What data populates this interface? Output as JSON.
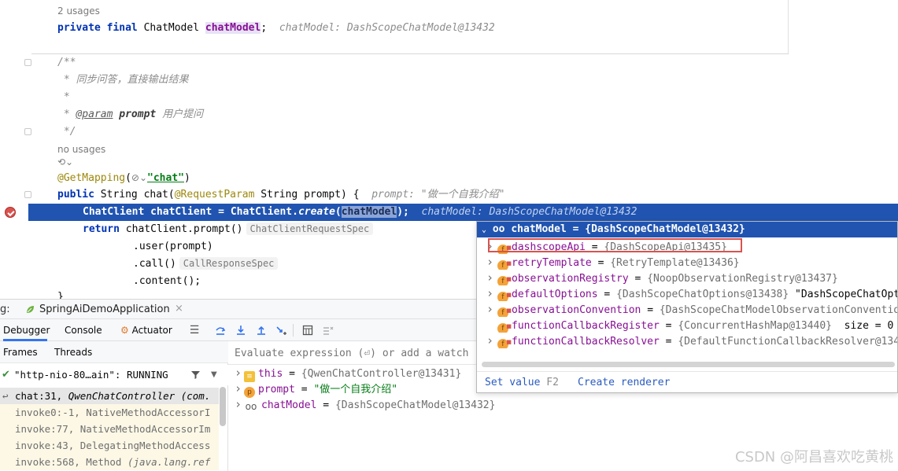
{
  "editor": {
    "field_usages": "2 usages",
    "field_kw1": "private",
    "field_kw2": "final",
    "field_type": "ChatModel",
    "field_name": "chatModel",
    "field_semi": ";",
    "field_inlay": "chatModel: DashScopeChatModel@13432",
    "javadoc_open": "/**",
    "javadoc_desc": " * 同步问答，直接输出结果",
    "javadoc_star": " *",
    "javadoc_param_prefix": " * ",
    "javadoc_param_tag": "@param",
    "javadoc_param_name": "prompt",
    "javadoc_param_desc": "用户提问",
    "javadoc_close": " */",
    "method_usages": "no usages",
    "annotation_icon": "⟲⌄",
    "mapping_ann": "@GetMapping",
    "mapping_open": "(",
    "mapping_icon": "⊘⌄",
    "mapping_path": "\"chat\"",
    "mapping_close": ")",
    "sig_kw": "public",
    "sig_rest1": " String chat(",
    "sig_ann": "@RequestParam",
    "sig_rest2": " String prompt) {",
    "sig_inlay": "prompt: \"做一个自我介绍\"",
    "exec_before": "ChatClient chatClient = ChatClient.",
    "exec_method": "create",
    "exec_paren": "(",
    "exec_sel": "chatModel",
    "exec_after": ");",
    "exec_inlay": "chatModel: DashScopeChatModel@13432",
    "ret_kw": "return",
    "ret_rest": " chatClient.prompt()",
    "ret_hint": "ChatClientRequestSpec",
    "user_line": ".user(prompt)",
    "call_line": ".call()",
    "call_hint": "CallResponseSpec",
    "content_line": ".content();",
    "close_brace": "}"
  },
  "debug": {
    "label": "g:",
    "config_name": "SpringAiDemoApplication",
    "config_close": "×",
    "tab_debugger": "Debugger",
    "tab_console": "Console",
    "tab_actuator": "Actuator",
    "tab_frames": "Frames",
    "tab_threads": "Threads",
    "thread_text": "\"http-nio-80…ain\": RUNNING",
    "frames": [
      {
        "method": "chat:31, ",
        "cls": "QwenChatController (com.",
        "selected": true
      },
      {
        "method": "invoke0:-1, NativeMethodAccessorI",
        "cls": "",
        "selected": false
      },
      {
        "method": "invoke:77, NativeMethodAccessorIm",
        "cls": "",
        "selected": false
      },
      {
        "method": "invoke:43, DelegatingMethodAccess",
        "cls": "",
        "selected": false
      },
      {
        "method": "invoke:568, Method ",
        "cls": "(java.lang.ref",
        "selected": false
      }
    ],
    "eval_placeholder": "Evaluate expression (⏎) or add a watch",
    "variables": [
      {
        "name": "this",
        "value": "{QwenChatController@13431}",
        "icon": "this-icon",
        "str": false
      },
      {
        "name": "prompt",
        "value": "\"做一个自我介绍\"",
        "icon": "parameter-icon",
        "str": true
      },
      {
        "name": "chatModel",
        "value": "{DashScopeChatModel@13432}",
        "icon": "watch-icon",
        "str": false
      }
    ]
  },
  "popup": {
    "title": "chatModel = {DashScopeChatModel@13432}",
    "fields": [
      {
        "name": "dashscopeApi",
        "value": "{DashScopeApi@13435}",
        "extra": "",
        "expandable": true
      },
      {
        "name": "retryTemplate",
        "value": "{RetryTemplate@13436}",
        "extra": "",
        "expandable": true
      },
      {
        "name": "observationRegistry",
        "value": "{NoopObservationRegistry@13437}",
        "extra": "",
        "expandable": true
      },
      {
        "name": "defaultOptions",
        "value": "{DashScopeChatOptions@13438}",
        "extra": " \"DashScopeChatOpt",
        "expandable": true
      },
      {
        "name": "observationConvention",
        "value": "{DashScopeChatModelObservationConventio",
        "extra": "",
        "expandable": true
      },
      {
        "name": "functionCallbackRegister",
        "value": "{ConcurrentHashMap@13440}",
        "extra": "  size = 0",
        "expandable": false
      },
      {
        "name": "functionCallbackResolver",
        "value": "{DefaultFunctionCallbackResolver@134",
        "extra": "",
        "expandable": true
      }
    ],
    "set_value": "Set value",
    "set_value_key": "F2",
    "create_renderer": "Create renderer"
  },
  "watermark": "CSDN @阿昌喜欢吃黄桃"
}
